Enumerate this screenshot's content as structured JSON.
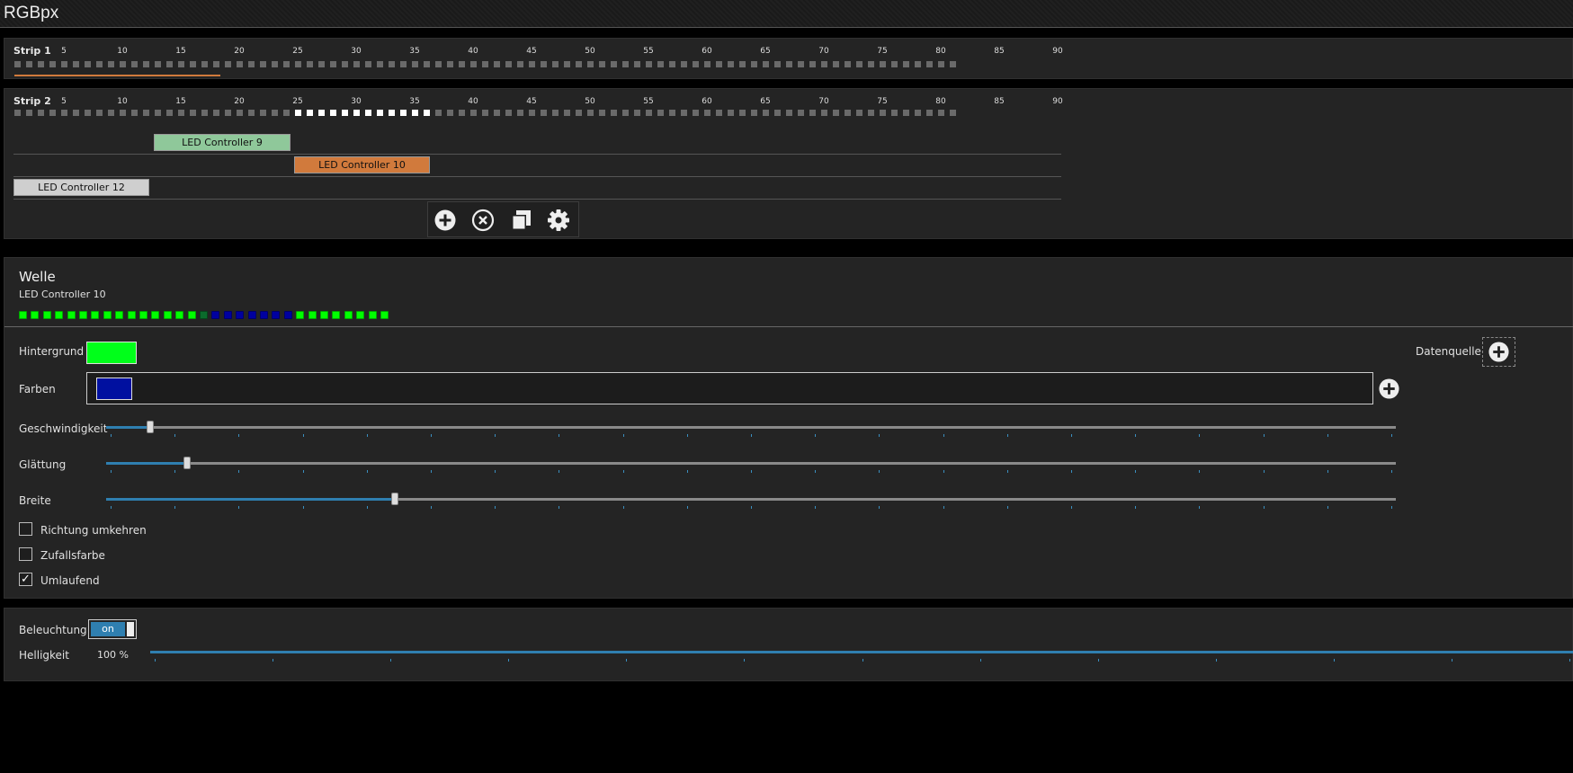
{
  "app": {
    "title": "RGBpx"
  },
  "strips": [
    {
      "label": "Strip 1",
      "active_from": 0,
      "active_to": 0
    },
    {
      "label": "Strip 2",
      "active_from": 25,
      "active_to": 36
    }
  ],
  "ruler_labels": [
    "5",
    "10",
    "15",
    "20",
    "25",
    "30",
    "35",
    "40",
    "45",
    "50",
    "55",
    "60",
    "65",
    "70",
    "75",
    "80",
    "85",
    "90"
  ],
  "controllers": [
    {
      "name": "LED Controller 9",
      "color": "#8fc89a"
    },
    {
      "name": "LED Controller 10",
      "color": "#d17a3c"
    },
    {
      "name": "LED Controller 12",
      "color": "#cfcfcf"
    }
  ],
  "toolbar": {
    "icons": [
      "add-icon",
      "remove-icon",
      "copy-icon",
      "settings-icon"
    ]
  },
  "effect": {
    "title": "Welle",
    "controller": "LED Controller 10",
    "preview_colors": [
      "#00ff00",
      "#00ff00",
      "#00ff00",
      "#00ff00",
      "#00ff00",
      "#00ff00",
      "#00ff00",
      "#00ff00",
      "#00ff00",
      "#00ff00",
      "#00ff00",
      "#00ff00",
      "#00ff00",
      "#00ff00",
      "#00ff00",
      "#0b6b2c",
      "#0000a0",
      "#0000a0",
      "#0000a0",
      "#0000a0",
      "#0000a0",
      "#0000a0",
      "#0000a0",
      "#00ff00",
      "#00ff00",
      "#00ff00",
      "#00ff00",
      "#00ff00",
      "#00ff00",
      "#00ff00",
      "#00ff00"
    ],
    "background_label": "Hintergrund",
    "background_color": "#00ff1a",
    "colors_label": "Farben",
    "colors": [
      "#0010a0"
    ],
    "datasource_label": "Datenquelle",
    "speed_label": "Geschwindigkeit",
    "speed_value": 0.034,
    "smoothing_label": "Glättung",
    "smoothing_value": 0.063,
    "width_label": "Breite",
    "width_value": 0.224,
    "reverse_label": "Richtung umkehren",
    "reverse_checked": false,
    "random_label": "Zufallsfarbe",
    "random_checked": false,
    "loop_label": "Umlaufend",
    "loop_checked": true
  },
  "lighting": {
    "label": "Beleuchtung",
    "toggle_text": "on",
    "brightness_label": "Helligkeit",
    "brightness_value": "100 %",
    "brightness_fraction": 1.0
  }
}
